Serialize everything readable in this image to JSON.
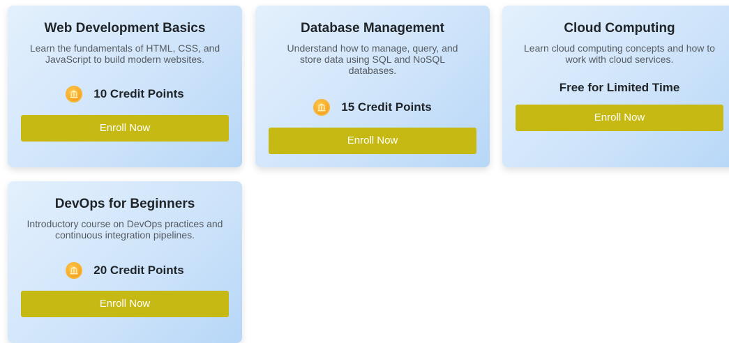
{
  "courses": [
    {
      "title": "Web Development Basics",
      "description": "Learn the fundamentals of HTML, CSS, and JavaScript to build modern websites.",
      "credits": "10 Credit Points",
      "button": "Enroll Now"
    },
    {
      "title": "Database Management",
      "description": "Understand how to manage, query, and store data using SQL and NoSQL databases.",
      "credits": "15 Credit Points",
      "button": "Enroll Now"
    },
    {
      "title": "Cloud Computing",
      "description": "Learn cloud computing concepts and how to work with cloud services.",
      "price_note": "Free for Limited Time",
      "button": "Enroll Now"
    },
    {
      "title": "DevOps for Beginners",
      "description": "Introductory course on DevOps practices and continuous integration pipelines.",
      "credits": "20 Credit Points",
      "button": "Enroll Now"
    }
  ],
  "icons": {
    "credit": "bank-coin-icon"
  },
  "colors": {
    "button": "#c6b913",
    "card_gradient_start": "#e3f0fd",
    "card_gradient_end": "#b7d7f7",
    "coin": "#f5a623"
  }
}
